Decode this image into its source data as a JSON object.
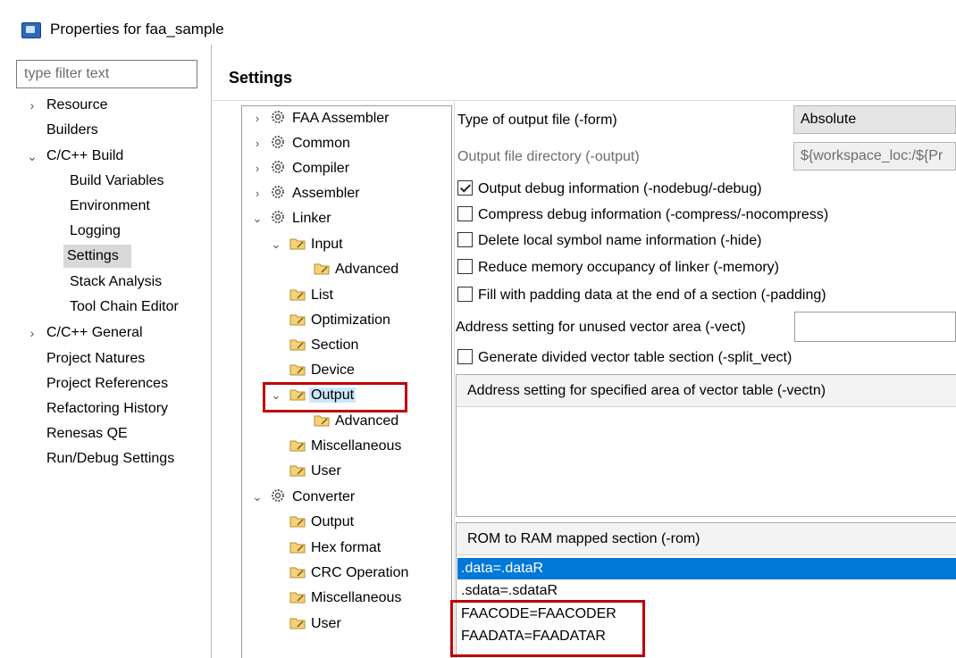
{
  "window": {
    "title": "Properties for faa_sample"
  },
  "filter": {
    "placeholder": "type filter text"
  },
  "nav": {
    "resource": "Resource",
    "builders": "Builders",
    "cpp_build": "C/C++ Build",
    "build_variables": "Build Variables",
    "environment": "Environment",
    "logging": "Logging",
    "settings": "Settings",
    "stack_analysis": "Stack Analysis",
    "tool_chain_editor": "Tool Chain Editor",
    "cpp_general": "C/C++ General",
    "project_natures": "Project Natures",
    "project_references": "Project References",
    "refactoring_history": "Refactoring History",
    "renesas_qe": "Renesas QE",
    "run_debug": "Run/Debug Settings"
  },
  "page": {
    "heading": "Settings"
  },
  "tree": {
    "faa_assembler": "FAA Assembler",
    "common": "Common",
    "compiler": "Compiler",
    "assembler": "Assembler",
    "linker": "Linker",
    "input": "Input",
    "input_advanced": "Advanced",
    "list": "List",
    "optimization": "Optimization",
    "section": "Section",
    "device": "Device",
    "output": "Output",
    "output_advanced": "Advanced",
    "miscellaneous": "Miscellaneous",
    "user": "User",
    "converter": "Converter",
    "conv_output": "Output",
    "hex_format": "Hex format",
    "crc_operation": "CRC Operation",
    "conv_miscellaneous": "Miscellaneous",
    "conv_user": "User"
  },
  "options": {
    "form_label": "Type of output file (-form)",
    "form_value": "Absolute",
    "output_dir_label": "Output file directory (-output)",
    "output_dir_value": "${workspace_loc:/${Pr",
    "debug_label": "Output debug information (-nodebug/-debug)",
    "debug_checked": true,
    "compress_label": "Compress debug information (-compress/-nocompress)",
    "compress_checked": false,
    "hide_label": "Delete local symbol name information (-hide)",
    "hide_checked": false,
    "memory_label": "Reduce memory occupancy of linker (-memory)",
    "memory_checked": false,
    "padding_label": "Fill with padding data at the end of a section (-padding)",
    "padding_checked": false,
    "vect_label": "Address setting for unused vector area (-vect)",
    "vect_value": "",
    "split_vect_label": "Generate divided vector table section (-split_vect)",
    "split_vect_checked": false,
    "vectn_header": "Address setting for specified area of vector table (-vectn)",
    "rom_header": "ROM to RAM mapped section (-rom)",
    "rom_items": [
      ".data=.dataR",
      ".sdata=.sdataR",
      "FAACODE=FAACODER",
      "FAADATA=FAADATAR"
    ]
  },
  "colors": {
    "highlight_border": "#c00000",
    "selection": "#0078d7",
    "tree_selection": "#cce8ff"
  }
}
